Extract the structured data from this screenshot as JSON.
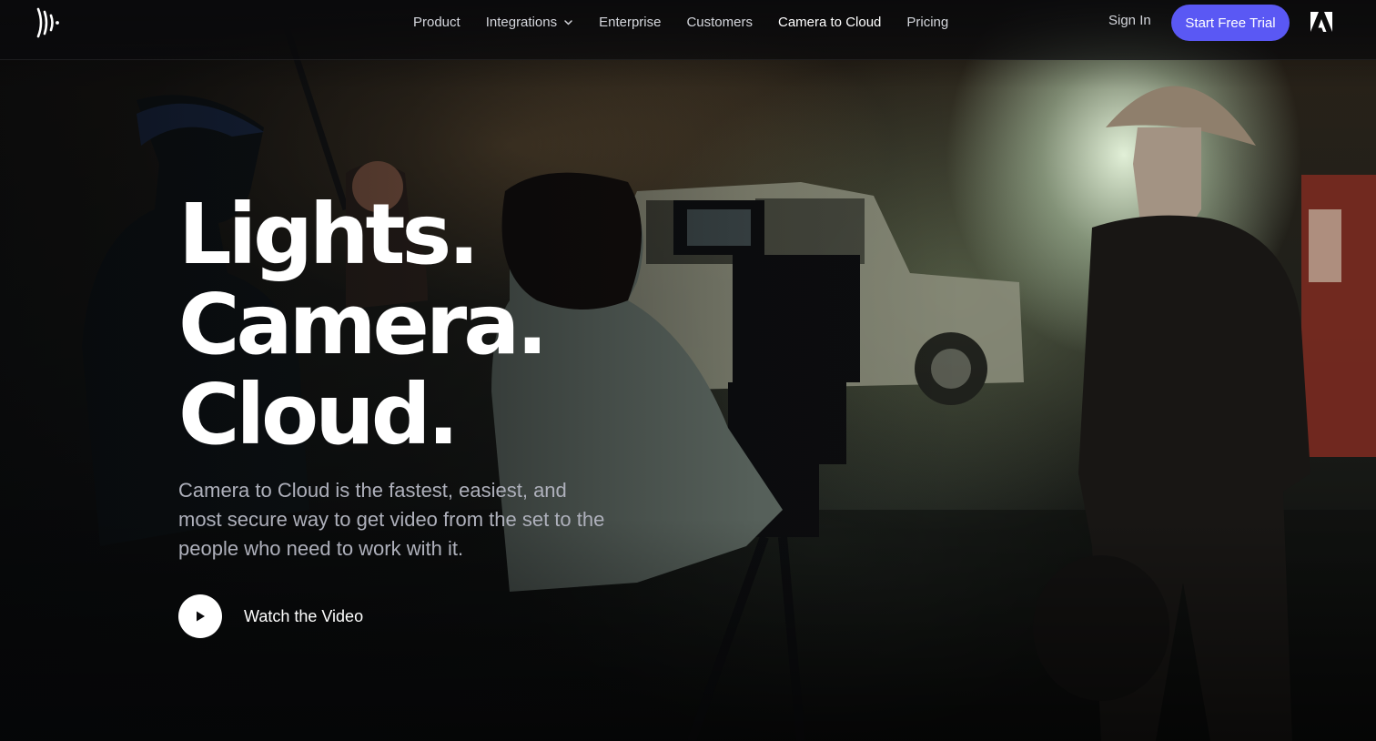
{
  "nav": {
    "links": [
      {
        "label": "Product"
      },
      {
        "label": "Integrations"
      },
      {
        "label": "Enterprise"
      },
      {
        "label": "Customers"
      },
      {
        "label": "Camera to Cloud"
      },
      {
        "label": "Pricing"
      }
    ],
    "sign_in": "Sign In",
    "cta": "Start Free Trial"
  },
  "hero": {
    "headline": [
      "Lights.",
      "Camera.",
      "Cloud."
    ],
    "subheadline": "Camera to Cloud is the fastest, easiest, and most secure way to get video from the set to the people who need to work with it.",
    "watch_video": "Watch the Video"
  },
  "colors": {
    "cta": "#5a58f4",
    "text_primary": "#ffffff",
    "text_secondary": "#aeb0bb"
  },
  "icons": [
    "frameio-logo-icon",
    "chevron-down-icon",
    "adobe-logo-icon",
    "play-icon"
  ]
}
